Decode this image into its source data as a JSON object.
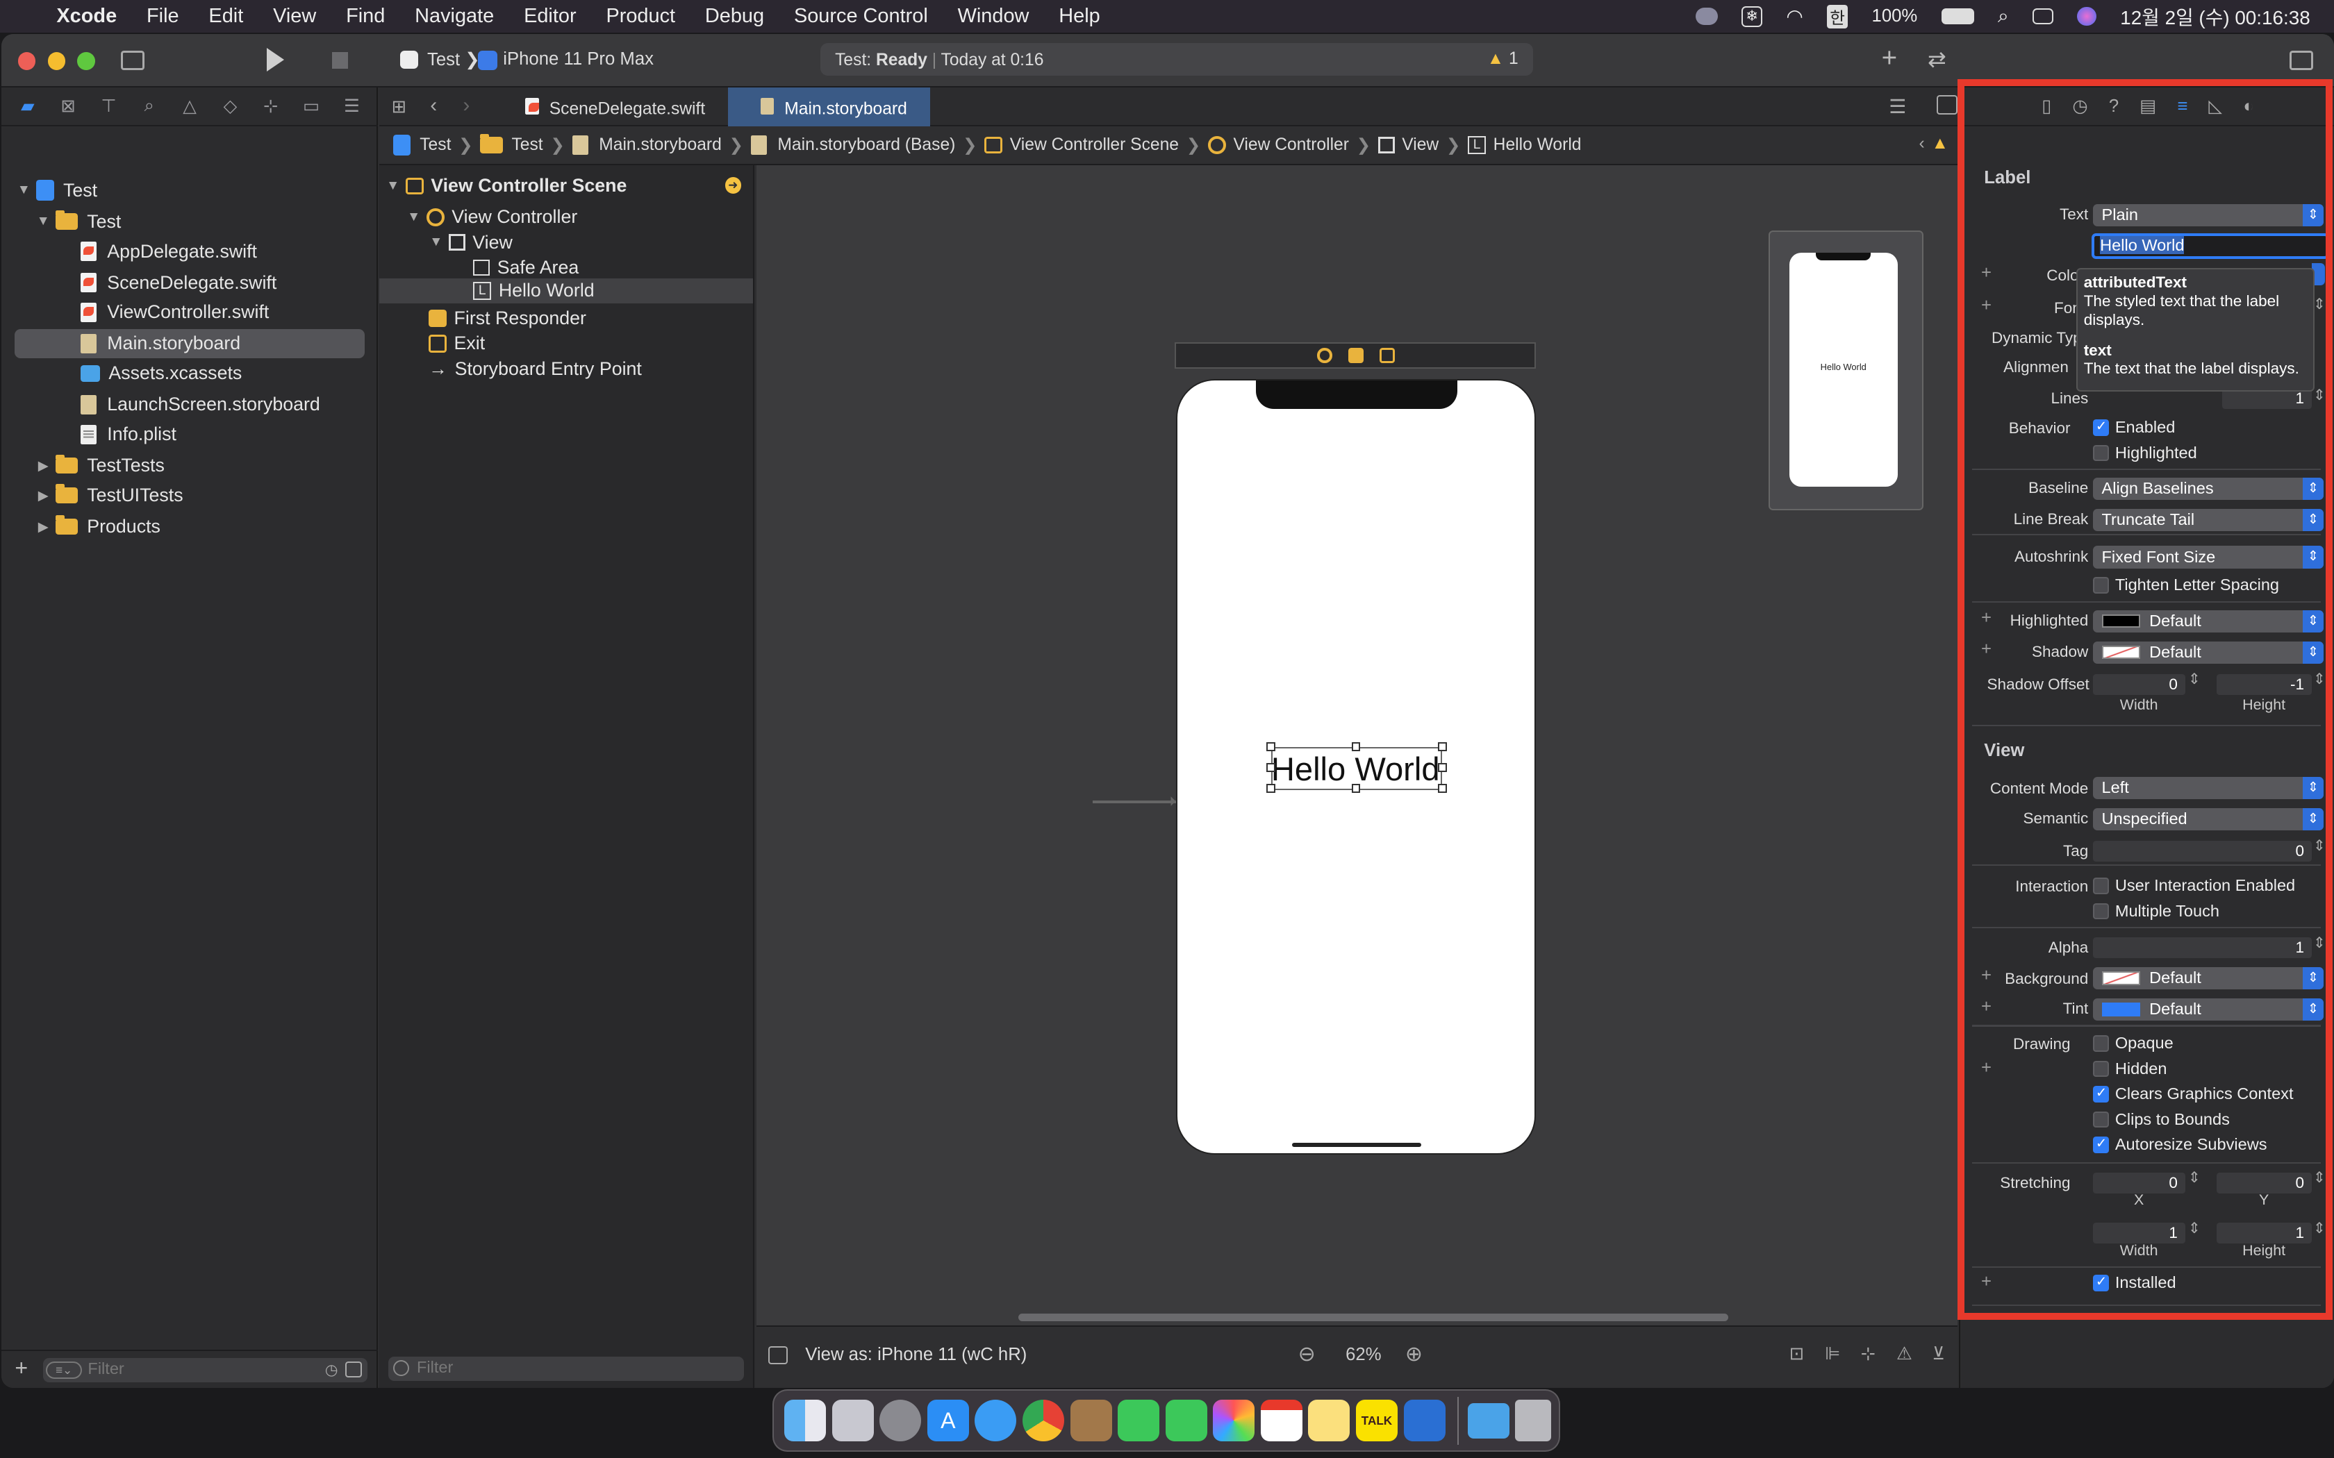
{
  "menubar": {
    "app_name": "Xcode",
    "items": [
      "File",
      "Edit",
      "View",
      "Find",
      "Navigate",
      "Editor",
      "Product",
      "Debug",
      "Source Control",
      "Window",
      "Help"
    ],
    "battery": "100%",
    "datetime": "12월 2일 (수) 00:16:38",
    "input_lang": "한"
  },
  "toolbar": {
    "scheme": "Test",
    "device": "iPhone 11 Pro Max",
    "status_prefix": "Test:",
    "status_state": "Ready",
    "status_time": "Today at 0:16",
    "warning_count": "1"
  },
  "navigator": {
    "project": "Test",
    "group": "Test",
    "files": [
      "AppDelegate.swift",
      "SceneDelegate.swift",
      "ViewController.swift",
      "Main.storyboard",
      "Assets.xcassets",
      "LaunchScreen.storyboard",
      "Info.plist"
    ],
    "groups": [
      "TestTests",
      "TestUITests",
      "Products"
    ],
    "filter_placeholder": "Filter"
  },
  "editor": {
    "tabs": [
      "SceneDelegate.swift",
      "Main.storyboard"
    ],
    "breadcrumb": [
      "Test",
      "Test",
      "Main.storyboard",
      "Main.storyboard (Base)",
      "View Controller Scene",
      "View Controller",
      "View",
      "Hello World"
    ]
  },
  "outline": {
    "scene": "View Controller Scene",
    "items": [
      "View Controller",
      "View",
      "Safe Area",
      "Hello World",
      "First Responder",
      "Exit",
      "Storyboard Entry Point"
    ],
    "filter_placeholder": "Filter"
  },
  "canvas": {
    "label_text": "Hello World",
    "minimap_text": "Hello World",
    "view_as": "View as: iPhone 11 (wC hR)",
    "zoom": "62%"
  },
  "inspector": {
    "label_section": "Label",
    "text_label": "Text",
    "text_type": "Plain",
    "text_value": "Hello World",
    "color_label": "Colo",
    "font_label": "Fon",
    "dynamic_label": "Dynamic Typ",
    "alignment_label": "Alignmen",
    "lines_label": "Lines",
    "lines_value": "1",
    "tooltip": {
      "t1": "attributedText",
      "d1": "The styled text that the label displays.",
      "t2": "text",
      "d2": "The text that the label displays."
    },
    "behavior_label": "Behavior",
    "enabled": "Enabled",
    "highlighted_cb": "Highlighted",
    "baseline_label": "Baseline",
    "baseline_value": "Align Baselines",
    "linebreak_label": "Line Break",
    "linebreak_value": "Truncate Tail",
    "autoshrink_label": "Autoshrink",
    "autoshrink_value": "Fixed Font Size",
    "tighten": "Tighten Letter Spacing",
    "highlighted_label": "Highlighted",
    "highlighted_value": "Default",
    "shadow_label": "Shadow",
    "shadow_value": "Default",
    "shadow_offset_label": "Shadow Offset",
    "shadow_w": "0",
    "shadow_h": "-1",
    "width_label": "Width",
    "height_label": "Height",
    "view_section": "View",
    "content_mode_label": "Content Mode",
    "content_mode_value": "Left",
    "semantic_label": "Semantic",
    "semantic_value": "Unspecified",
    "tag_label": "Tag",
    "tag_value": "0",
    "interaction_label": "Interaction",
    "uie": "User Interaction Enabled",
    "multitouch": "Multiple Touch",
    "alpha_label": "Alpha",
    "alpha_value": "1",
    "background_label": "Background",
    "background_value": "Default",
    "tint_label": "Tint",
    "tint_value": "Default",
    "drawing_label": "Drawing",
    "opaque": "Opaque",
    "hidden": "Hidden",
    "clears": "Clears Graphics Context",
    "clips": "Clips to Bounds",
    "autoresize": "Autoresize Subviews",
    "stretching_label": "Stretching",
    "st_x": "0",
    "st_y": "0",
    "st_w": "1",
    "st_h": "1",
    "x_label": "X",
    "y_label": "Y",
    "installed": "Installed"
  },
  "colors": {
    "accent": "#2f7cf6",
    "highlight_box": "#e8392b",
    "warning": "#f5c242"
  }
}
